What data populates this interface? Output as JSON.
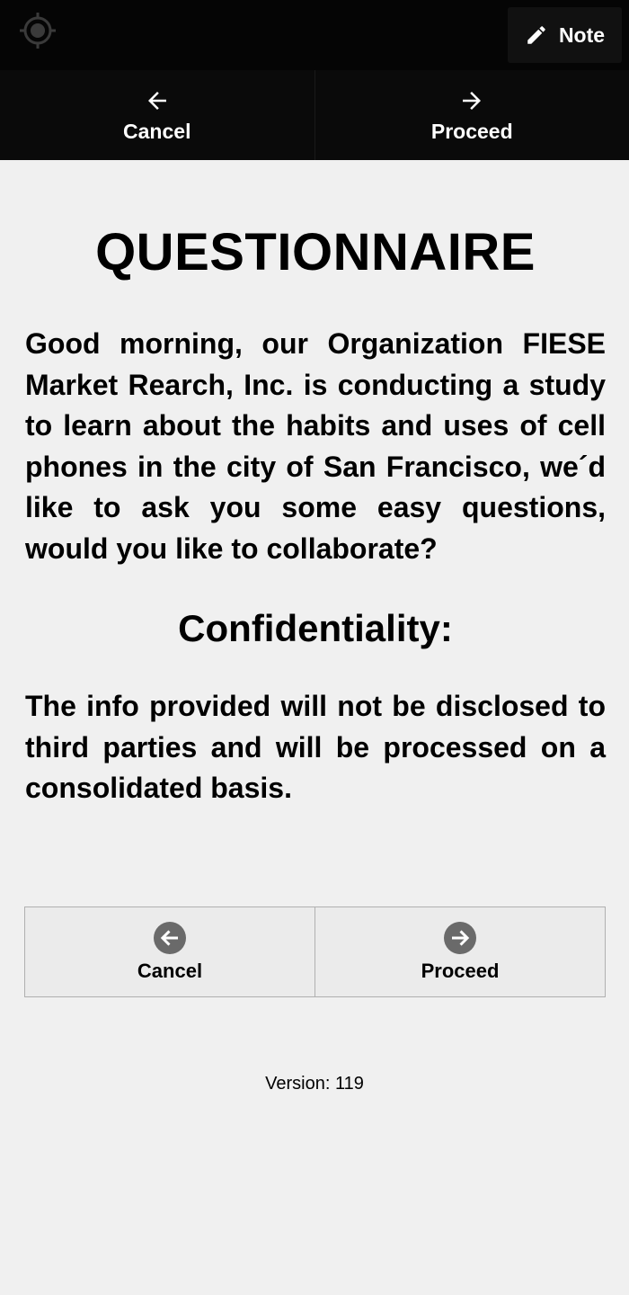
{
  "topbar": {
    "gps_icon": "gps-target-icon",
    "note_label": "Note",
    "note_icon": "pencil-icon"
  },
  "nav": {
    "cancel_label": "Cancel",
    "proceed_label": "Proceed",
    "cancel_icon": "arrow-left-icon",
    "proceed_icon": "arrow-right-icon"
  },
  "main": {
    "title": "QUESTIONNAIRE",
    "intro": "Good morning, our Organization FIESE Market Rearch, Inc. is conducting a study to learn about the habits and uses of cell phones in the city of San Francisco, we´d like to ask you some easy questions, would you like to collaborate?",
    "subtitle": "Confidentiality:",
    "confidentiality_text": "The info provided will not be disclosed to third parties and will be processed on a consolidated basis."
  },
  "actions": {
    "cancel_label": "Cancel",
    "proceed_label": "Proceed"
  },
  "footer": {
    "version": "Version: 119"
  },
  "colors": {
    "topbar_bg": "#050505",
    "page_bg": "#f0f0f0",
    "circle_icon": "#6a6a6a"
  }
}
